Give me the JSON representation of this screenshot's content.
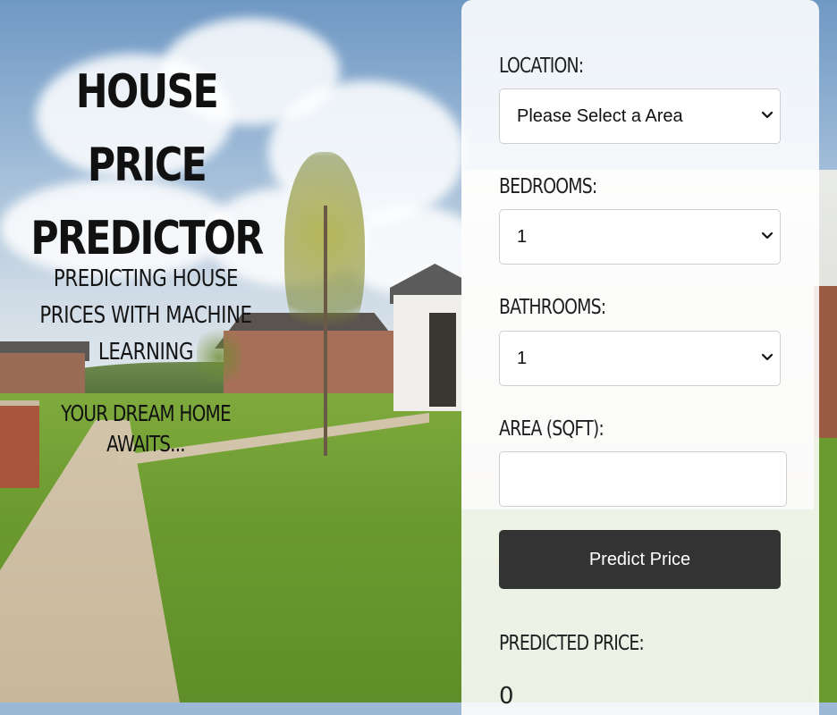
{
  "hero": {
    "title": "HOUSE PRICE PREDICTOR",
    "subtitle": "PREDICTING HOUSE PRICES WITH MACHINE LEARNING",
    "tagline": "YOUR DREAM HOME AWAITS..."
  },
  "form": {
    "location_label": "LOCATION:",
    "location_value": "Please Select a Area",
    "bedrooms_label": "BEDROOMS:",
    "bedrooms_value": "1",
    "bathrooms_label": "BATHROOMS:",
    "bathrooms_value": "1",
    "area_label": "AREA (SQFT):",
    "area_value": "",
    "predict_button": "Predict Price"
  },
  "result": {
    "label": "PREDICTED PRICE:",
    "value": "0"
  },
  "colors": {
    "button_bg": "#333333",
    "panel_bg": "#ffffff"
  },
  "icons": {
    "select_chevron": "chevron-down-icon"
  }
}
